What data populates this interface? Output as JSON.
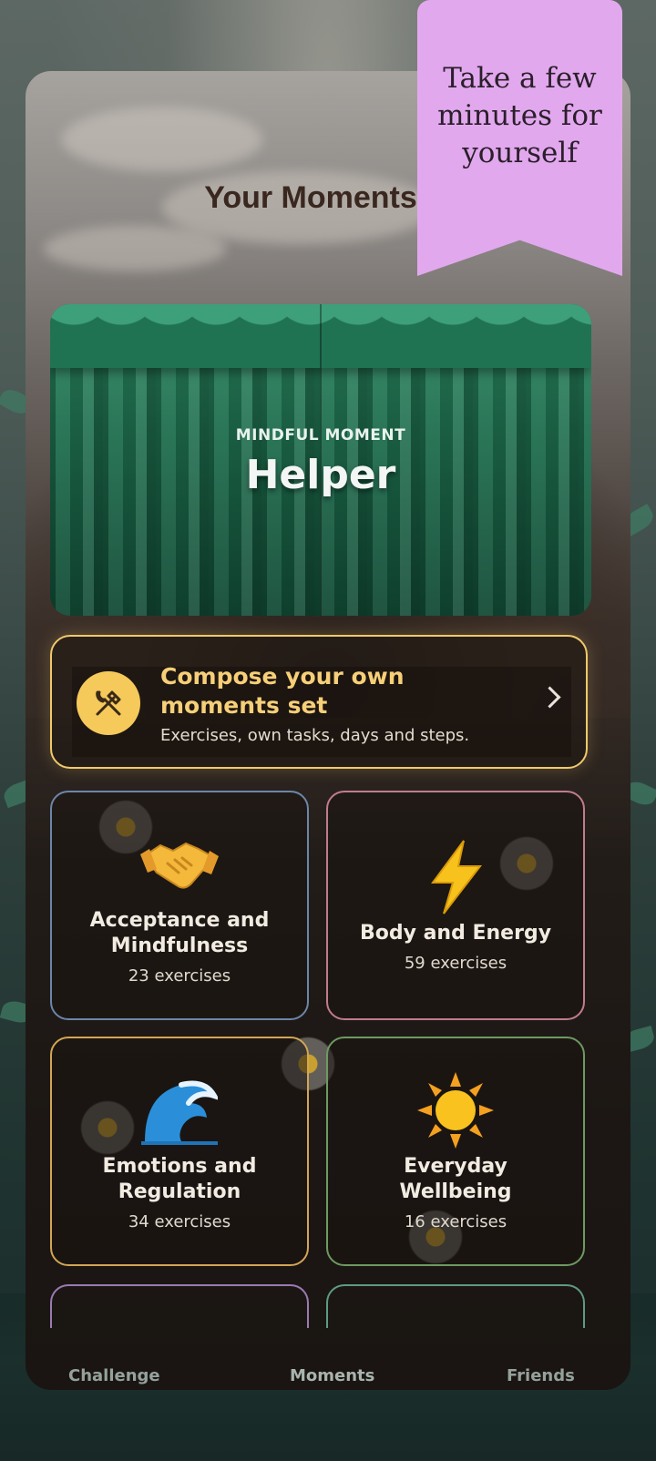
{
  "screen": {
    "title": "Your Moments"
  },
  "banner": {
    "text": "Take a few minutes for yourself"
  },
  "featured": {
    "eyebrow": "MINDFUL MOMENT",
    "title": "Helper"
  },
  "compose": {
    "title": "Compose your own moments set",
    "subtitle": "Exercises, own tasks, days and steps.",
    "icon": "tools-icon"
  },
  "categories": [
    {
      "name": "Acceptance and Mindfulness",
      "count": "23 exercises",
      "icon": "handshake-icon",
      "border": "#6c86a8"
    },
    {
      "name": "Body and Energy",
      "count": "59 exercises",
      "icon": "lightning-icon",
      "border": "#c07c8e"
    },
    {
      "name": "Emotions and Regulation",
      "count": "34 exercises",
      "icon": "wave-icon",
      "border": "#d3a655"
    },
    {
      "name": "Everyday Wellbeing",
      "count": "16 exercises",
      "icon": "sun-icon",
      "border": "#6d9a62"
    }
  ],
  "nav": {
    "items": [
      "Challenge",
      "Moments",
      "Friends"
    ],
    "active": "Moments"
  },
  "colors": {
    "accent": "#f1c96a",
    "banner": "#e2a8ee",
    "curtain": "#1e6e4e"
  }
}
